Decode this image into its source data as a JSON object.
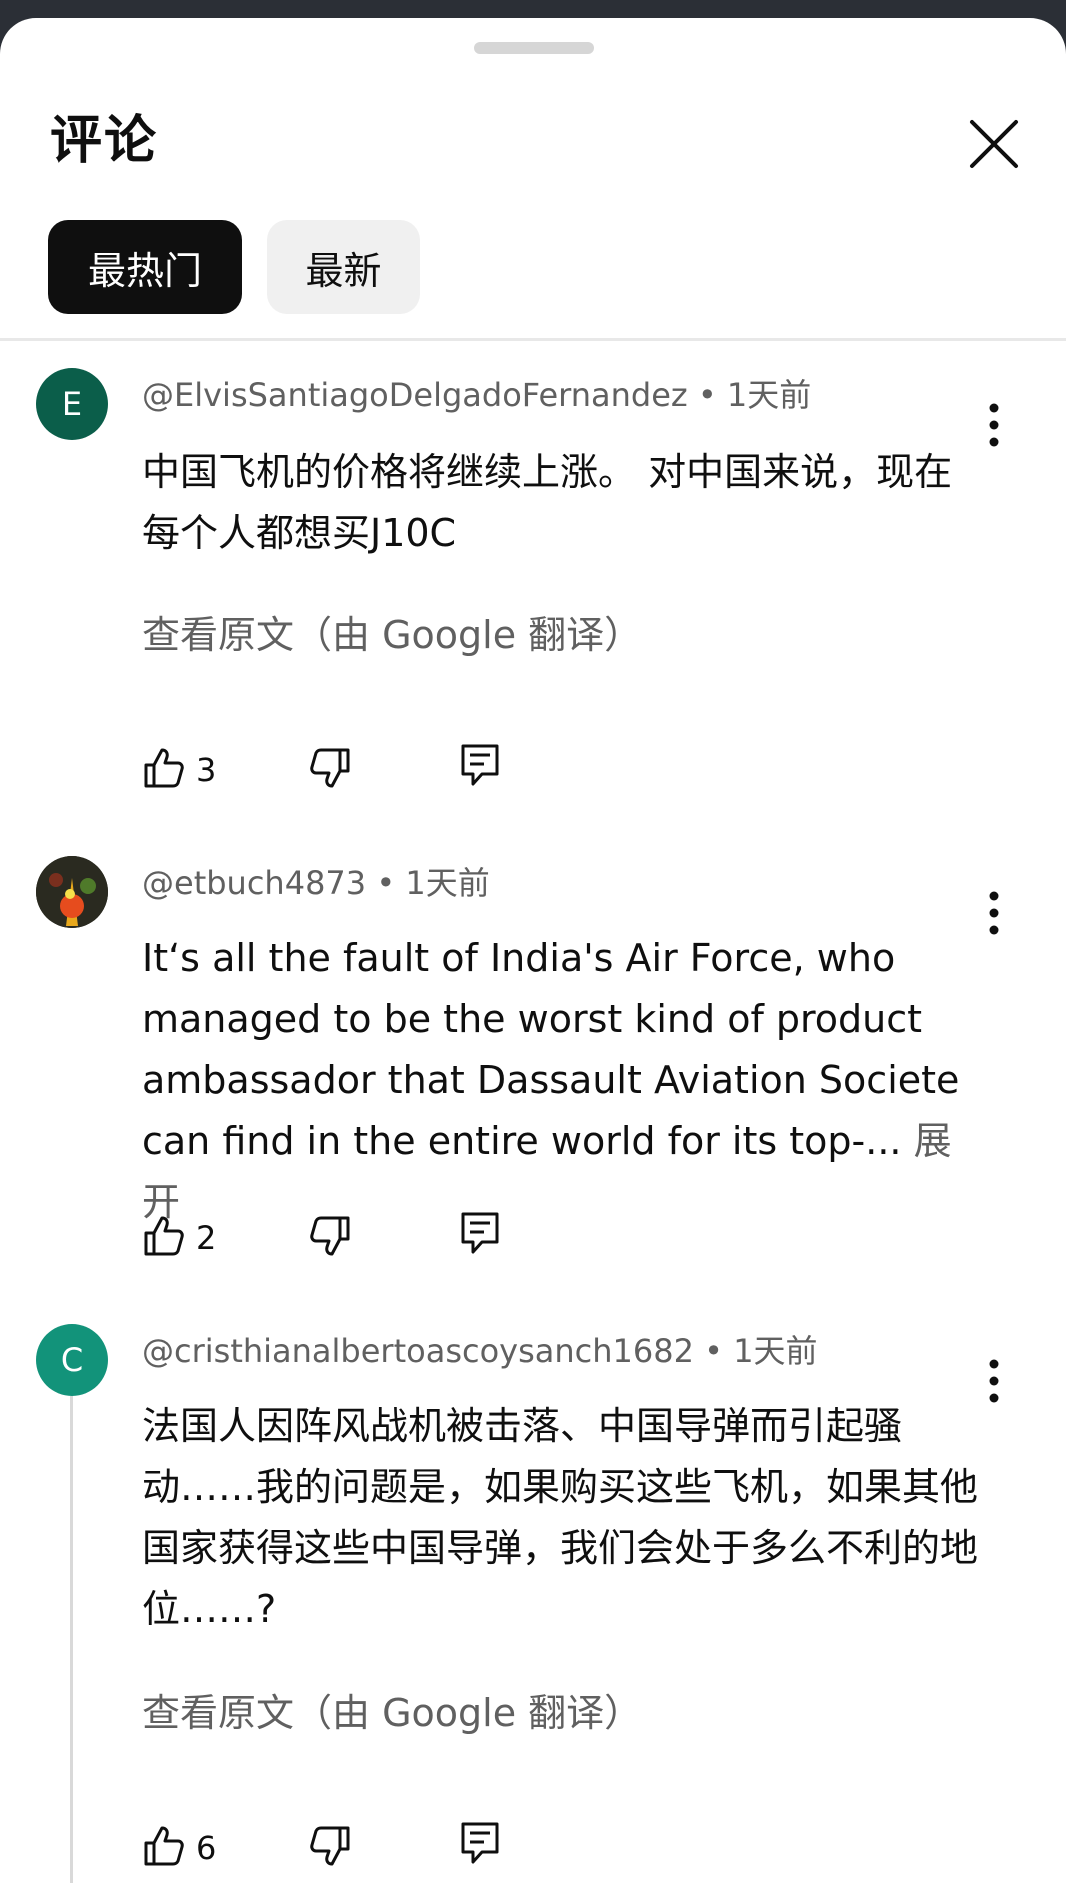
{
  "header": {
    "title": "评论",
    "close_icon": "close-icon"
  },
  "tabs": [
    {
      "label": "最热门",
      "active": true
    },
    {
      "label": "最新",
      "active": false
    }
  ],
  "comments": [
    {
      "avatar_letter": "E",
      "avatar_color": "#0b5e4a",
      "author": "@ElvisSantiagoDelgadoFernandez",
      "time": "• 1天前",
      "text": "中国飞机的价格将继续上涨。 对中国来说，现在每个人都想买J10C",
      "translate_label": "查看原文（由 Google 翻译）",
      "likes": "3"
    },
    {
      "avatar_letter": "",
      "avatar_color": "#3a3a2a",
      "author": "@etbuch4873",
      "time": "• 1天前",
      "text": "It‘s all the fault of India's Air Force, who managed to be the worst kind of product ambassador that Dassault Aviation Societe can find in the entire world for its top-...",
      "expand_label": "展开",
      "likes": "2"
    },
    {
      "avatar_letter": "C",
      "avatar_color": "#12937a",
      "author": "@cristhianalbertoascoysanch1682",
      "time": "• 1天前",
      "text": "法国人因阵风战机被击落、中国导弹而引起骚动……我的问题是，如果购买这些飞机，如果其他国家获得这些中国导弹，我们会处于多么不利的地位……?",
      "translate_label": "查看原文（由 Google 翻译）",
      "likes": "6"
    }
  ],
  "icons": {
    "like": "thumbs-up-icon",
    "dislike": "thumbs-down-icon",
    "reply": "reply-icon",
    "more": "more-vertical-icon"
  }
}
